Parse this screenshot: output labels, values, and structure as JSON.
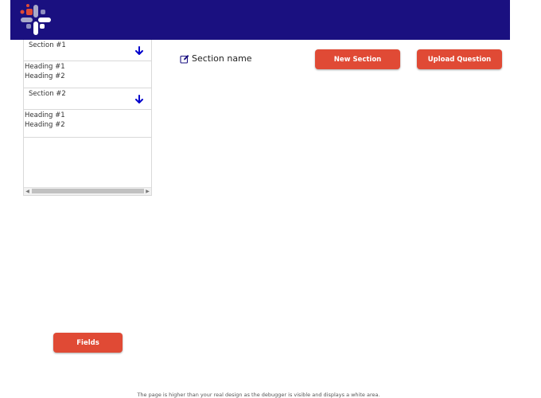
{
  "header": {
    "logo_icon": "cross-logo-icon",
    "background_color": "#1a1080"
  },
  "sidebar": {
    "sections": [
      {
        "title": "Section #1",
        "headings": [
          "Heading #1",
          "Heading #2"
        ]
      },
      {
        "title": "Section #2",
        "headings": [
          "Heading #1",
          "Heading #2"
        ]
      }
    ],
    "arrow_icon": "arrow-down-icon",
    "arrow_color": "#0000cc"
  },
  "main": {
    "section_name_label": "Section name",
    "edit_icon": "edit-icon",
    "new_section_label": "New Section",
    "upload_question_label": "Upload Question"
  },
  "fields_button_label": "Fields",
  "accent_color": "#e04a35",
  "footer_note": "The page is higher than your real design as the debugger is visible and displays a white area."
}
